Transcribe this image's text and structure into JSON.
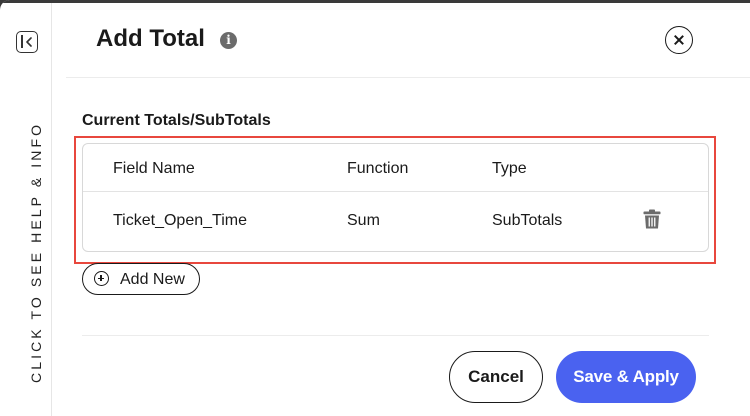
{
  "help_rail": {
    "text": "CLICK TO SEE HELP & INFO",
    "collapse_icon": "panel-collapse-icon"
  },
  "header": {
    "title": "Add Total",
    "info_icon": "info-icon",
    "info_glyph": "i",
    "close_icon": "close-icon"
  },
  "section": {
    "label": "Current Totals/SubTotals"
  },
  "table": {
    "columns": [
      "Field Name",
      "Function",
      "Type"
    ],
    "rows": [
      {
        "field_name": "Ticket_Open_Time",
        "function": "Sum",
        "type": "SubTotals",
        "action_icon": "trash-icon"
      }
    ]
  },
  "actions": {
    "add_new_label": "Add New",
    "add_new_icon": "plus-circle-icon",
    "cancel_label": "Cancel",
    "save_label": "Save & Apply"
  },
  "colors": {
    "accent": "#4a62f0",
    "highlight_border": "#e8473d",
    "text": "#1a1a1a"
  }
}
